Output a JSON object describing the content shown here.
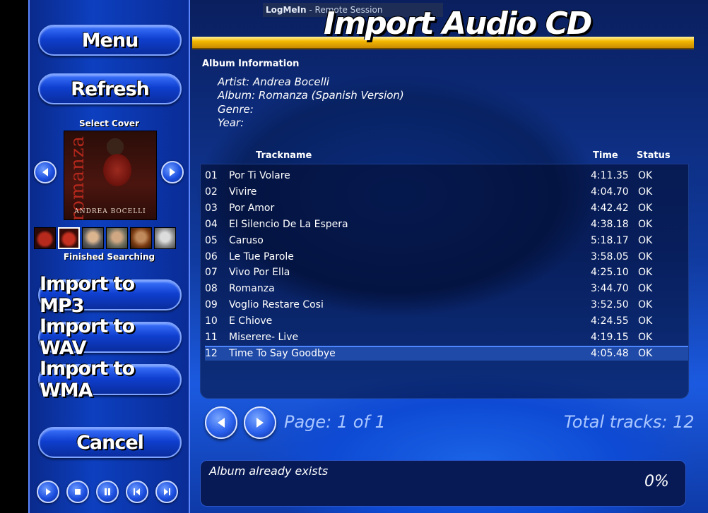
{
  "window": {
    "session_label_bold": "LogMeIn",
    "session_label": " - Remote Session",
    "title": "Import Audio CD"
  },
  "sidebar": {
    "menu_label": "Menu",
    "refresh_label": "Refresh",
    "select_cover_label": "Select Cover",
    "cover_art_text": "romanza",
    "cover_artist_text": "ANDREA BOCELLI",
    "search_status": "Finished Searching",
    "import_mp3_label": "Import to MP3",
    "import_wav_label": "Import to WAV",
    "import_wma_label": "Import to WMA",
    "cancel_label": "Cancel"
  },
  "album": {
    "section_label": "Album Information",
    "artist_line": "Artist: Andrea Bocelli",
    "album_line": "Album:  Romanza (Spanish Version)",
    "genre_line": "Genre:",
    "year_line": "Year:"
  },
  "columns": {
    "trackname": "Trackname",
    "time": "Time",
    "status": "Status"
  },
  "tracks": [
    {
      "num": "01",
      "name": "Por Ti Volare",
      "time": "4:11.35",
      "status": "OK"
    },
    {
      "num": "02",
      "name": "Vivire",
      "time": "4:04.70",
      "status": "OK"
    },
    {
      "num": "03",
      "name": "Por Amor",
      "time": "4:42.42",
      "status": "OK"
    },
    {
      "num": "04",
      "name": "El Silencio De La Espera",
      "time": "4:38.18",
      "status": "OK"
    },
    {
      "num": "05",
      "name": "Caruso",
      "time": "5:18.17",
      "status": "OK"
    },
    {
      "num": "06",
      "name": "Le Tue Parole",
      "time": "3:58.05",
      "status": "OK"
    },
    {
      "num": "07",
      "name": "Vivo Por Ella",
      "time": "4:25.10",
      "status": "OK"
    },
    {
      "num": "08",
      "name": "Romanza",
      "time": "3:44.70",
      "status": "OK"
    },
    {
      "num": "09",
      "name": "Voglio Restare Cosi",
      "time": "3:52.50",
      "status": "OK"
    },
    {
      "num": "10",
      "name": "E Chiove",
      "time": "4:24.55",
      "status": "OK"
    },
    {
      "num": "11",
      "name": "Miserere- Live",
      "time": "4:19.15",
      "status": "OK"
    },
    {
      "num": "12",
      "name": "Time To Say Goodbye",
      "time": "4:05.48",
      "status": "OK"
    }
  ],
  "selected_track": "12",
  "pagination": {
    "page_text": "Page: 1 of 1",
    "total_text": "Total tracks: 12"
  },
  "status": {
    "message": "Album already exists",
    "progress": "0%"
  },
  "colors": {
    "accent_gold": "#f4b800",
    "sidebar_blue": "#0d3fbf",
    "selection_blue": "#1f4aa8"
  }
}
